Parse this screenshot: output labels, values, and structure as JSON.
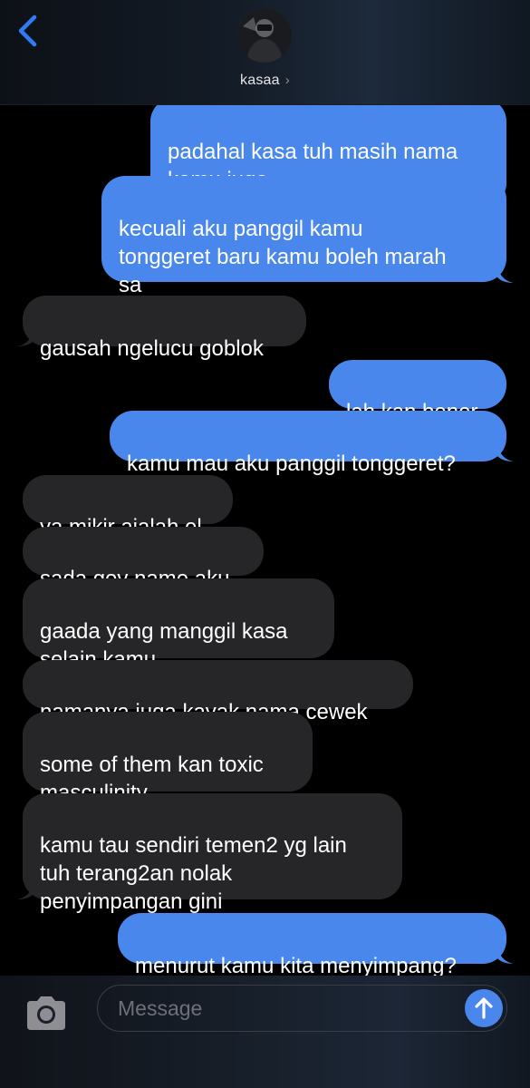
{
  "header": {
    "contact_name": "kasaa",
    "chevron": "›"
  },
  "messages": [
    {
      "id": 1,
      "side": "out",
      "text": "padahal kasa tuh masih nama\nkamu juga"
    },
    {
      "id": 2,
      "side": "out",
      "text": "kecuali aku panggil kamu\ntonggeret baru kamu boleh marah\nsa"
    },
    {
      "id": 3,
      "side": "in",
      "text": "gausah ngelucu goblok"
    },
    {
      "id": 4,
      "side": "out",
      "text": "lah kan bener"
    },
    {
      "id": 5,
      "side": "out",
      "text": "kamu mau aku panggil tonggeret?"
    },
    {
      "id": 6,
      "side": "in",
      "text": "ya mikir ajalah el"
    },
    {
      "id": 7,
      "side": "in",
      "text": "sada gov name aku"
    },
    {
      "id": 8,
      "side": "in",
      "text": "gaada yang manggil kasa\nselain kamu"
    },
    {
      "id": 9,
      "side": "in",
      "text": "namanya juga kayak nama cewek"
    },
    {
      "id": 10,
      "side": "in",
      "text": "some of them kan toxic\nmasculinity"
    },
    {
      "id": 11,
      "side": "in",
      "text": "kamu tau sendiri temen2 yg lain\ntuh terang2an nolak\npenyimpangan gini"
    },
    {
      "id": 12,
      "side": "out",
      "text": "menurut kamu kita menyimpang?"
    }
  ],
  "composer": {
    "placeholder": "Message",
    "value": ""
  },
  "icons": {
    "back": "chevron-left-icon",
    "camera": "camera-icon",
    "send": "arrow-up-icon"
  },
  "colors": {
    "outgoing_bubble": "#4a87ec",
    "incoming_bubble": "#262628",
    "accent": "#2f7cf6"
  }
}
